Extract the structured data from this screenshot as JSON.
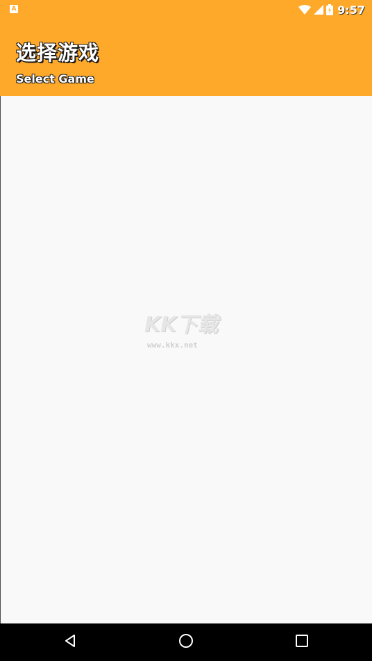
{
  "status_bar": {
    "time": "9:57",
    "notification_icon": "a-icon",
    "icons": [
      "wifi-icon",
      "signal-icon",
      "battery-icon"
    ]
  },
  "header": {
    "title_cn": "选择游戏",
    "title_en": "Select Game",
    "background_color": "#ffa92a"
  },
  "watermark": {
    "logo_text": "KK下载",
    "url": "www.kkx.net"
  },
  "nav_bar": {
    "buttons": [
      "back-icon",
      "home-icon",
      "recent-apps-icon"
    ]
  }
}
